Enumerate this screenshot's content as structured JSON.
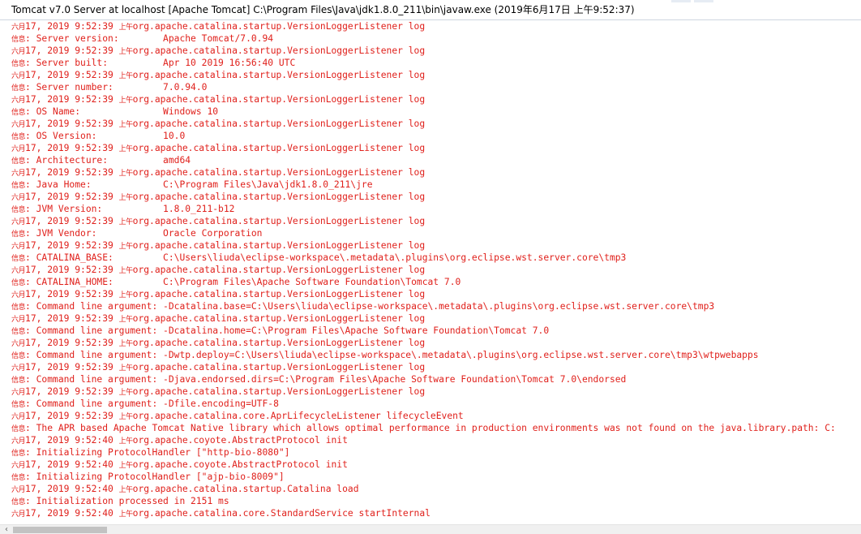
{
  "window": {
    "title": "Tomcat v7.0 Server at localhost [Apache Tomcat] C:\\Program Files\\Java\\jdk1.8.0_211\\bin\\javaw.exe (2019年6月17日 上午9:52:37)"
  },
  "colors": {
    "log_text": "#e0201b",
    "background": "#ffffff"
  },
  "console": {
    "lines": [
      {
        "p": "六月",
        "t": "17, 2019 9:52:39 ",
        "ap": "上午",
        "r": "org.apache.catalina.startup.VersionLoggerListener log"
      },
      {
        "p": "信息",
        "t": ": Server version:        Apache Tomcat/7.0.94",
        "ap": "",
        "r": ""
      },
      {
        "p": "六月",
        "t": "17, 2019 9:52:39 ",
        "ap": "上午",
        "r": "org.apache.catalina.startup.VersionLoggerListener log"
      },
      {
        "p": "信息",
        "t": ": Server built:          Apr 10 2019 16:56:40 UTC",
        "ap": "",
        "r": ""
      },
      {
        "p": "六月",
        "t": "17, 2019 9:52:39 ",
        "ap": "上午",
        "r": "org.apache.catalina.startup.VersionLoggerListener log"
      },
      {
        "p": "信息",
        "t": ": Server number:         7.0.94.0",
        "ap": "",
        "r": ""
      },
      {
        "p": "六月",
        "t": "17, 2019 9:52:39 ",
        "ap": "上午",
        "r": "org.apache.catalina.startup.VersionLoggerListener log"
      },
      {
        "p": "信息",
        "t": ": OS Name:               Windows 10",
        "ap": "",
        "r": ""
      },
      {
        "p": "六月",
        "t": "17, 2019 9:52:39 ",
        "ap": "上午",
        "r": "org.apache.catalina.startup.VersionLoggerListener log"
      },
      {
        "p": "信息",
        "t": ": OS Version:            10.0",
        "ap": "",
        "r": ""
      },
      {
        "p": "六月",
        "t": "17, 2019 9:52:39 ",
        "ap": "上午",
        "r": "org.apache.catalina.startup.VersionLoggerListener log"
      },
      {
        "p": "信息",
        "t": ": Architecture:          amd64",
        "ap": "",
        "r": ""
      },
      {
        "p": "六月",
        "t": "17, 2019 9:52:39 ",
        "ap": "上午",
        "r": "org.apache.catalina.startup.VersionLoggerListener log"
      },
      {
        "p": "信息",
        "t": ": Java Home:             C:\\Program Files\\Java\\jdk1.8.0_211\\jre",
        "ap": "",
        "r": ""
      },
      {
        "p": "六月",
        "t": "17, 2019 9:52:39 ",
        "ap": "上午",
        "r": "org.apache.catalina.startup.VersionLoggerListener log"
      },
      {
        "p": "信息",
        "t": ": JVM Version:           1.8.0_211-b12",
        "ap": "",
        "r": ""
      },
      {
        "p": "六月",
        "t": "17, 2019 9:52:39 ",
        "ap": "上午",
        "r": "org.apache.catalina.startup.VersionLoggerListener log"
      },
      {
        "p": "信息",
        "t": ": JVM Vendor:            Oracle Corporation",
        "ap": "",
        "r": ""
      },
      {
        "p": "六月",
        "t": "17, 2019 9:52:39 ",
        "ap": "上午",
        "r": "org.apache.catalina.startup.VersionLoggerListener log"
      },
      {
        "p": "信息",
        "t": ": CATALINA_BASE:         C:\\Users\\liuda\\eclipse-workspace\\.metadata\\.plugins\\org.eclipse.wst.server.core\\tmp3",
        "ap": "",
        "r": ""
      },
      {
        "p": "六月",
        "t": "17, 2019 9:52:39 ",
        "ap": "上午",
        "r": "org.apache.catalina.startup.VersionLoggerListener log"
      },
      {
        "p": "信息",
        "t": ": CATALINA_HOME:         C:\\Program Files\\Apache Software Foundation\\Tomcat 7.0",
        "ap": "",
        "r": ""
      },
      {
        "p": "六月",
        "t": "17, 2019 9:52:39 ",
        "ap": "上午",
        "r": "org.apache.catalina.startup.VersionLoggerListener log"
      },
      {
        "p": "信息",
        "t": ": Command line argument: -Dcatalina.base=C:\\Users\\liuda\\eclipse-workspace\\.metadata\\.plugins\\org.eclipse.wst.server.core\\tmp3",
        "ap": "",
        "r": ""
      },
      {
        "p": "六月",
        "t": "17, 2019 9:52:39 ",
        "ap": "上午",
        "r": "org.apache.catalina.startup.VersionLoggerListener log"
      },
      {
        "p": "信息",
        "t": ": Command line argument: -Dcatalina.home=C:\\Program Files\\Apache Software Foundation\\Tomcat 7.0",
        "ap": "",
        "r": ""
      },
      {
        "p": "六月",
        "t": "17, 2019 9:52:39 ",
        "ap": "上午",
        "r": "org.apache.catalina.startup.VersionLoggerListener log"
      },
      {
        "p": "信息",
        "t": ": Command line argument: -Dwtp.deploy=C:\\Users\\liuda\\eclipse-workspace\\.metadata\\.plugins\\org.eclipse.wst.server.core\\tmp3\\wtpwebapps",
        "ap": "",
        "r": ""
      },
      {
        "p": "六月",
        "t": "17, 2019 9:52:39 ",
        "ap": "上午",
        "r": "org.apache.catalina.startup.VersionLoggerListener log"
      },
      {
        "p": "信息",
        "t": ": Command line argument: -Djava.endorsed.dirs=C:\\Program Files\\Apache Software Foundation\\Tomcat 7.0\\endorsed",
        "ap": "",
        "r": ""
      },
      {
        "p": "六月",
        "t": "17, 2019 9:52:39 ",
        "ap": "上午",
        "r": "org.apache.catalina.startup.VersionLoggerListener log"
      },
      {
        "p": "信息",
        "t": ": Command line argument: -Dfile.encoding=UTF-8",
        "ap": "",
        "r": ""
      },
      {
        "p": "六月",
        "t": "17, 2019 9:52:39 ",
        "ap": "上午",
        "r": "org.apache.catalina.core.AprLifecycleListener lifecycleEvent"
      },
      {
        "p": "信息",
        "t": ": The APR based Apache Tomcat Native library which allows optimal performance in production environments was not found on the java.library.path: C:",
        "ap": "",
        "r": ""
      },
      {
        "p": "六月",
        "t": "17, 2019 9:52:40 ",
        "ap": "上午",
        "r": "org.apache.coyote.AbstractProtocol init"
      },
      {
        "p": "信息",
        "t": ": Initializing ProtocolHandler [\"http-bio-8080\"]",
        "ap": "",
        "r": ""
      },
      {
        "p": "六月",
        "t": "17, 2019 9:52:40 ",
        "ap": "上午",
        "r": "org.apache.coyote.AbstractProtocol init"
      },
      {
        "p": "信息",
        "t": ": Initializing ProtocolHandler [\"ajp-bio-8009\"]",
        "ap": "",
        "r": ""
      },
      {
        "p": "六月",
        "t": "17, 2019 9:52:40 ",
        "ap": "上午",
        "r": "org.apache.catalina.startup.Catalina load"
      },
      {
        "p": "信息",
        "t": ": Initialization processed in 2151 ms",
        "ap": "",
        "r": ""
      },
      {
        "p": "六月",
        "t": "17, 2019 9:52:40 ",
        "ap": "上午",
        "r": "org.apache.catalina.core.StandardService startInternal"
      }
    ]
  },
  "scrollbar": {
    "left_arrow_icon": "chevron-left-icon",
    "left_arrow_glyph": "‹"
  }
}
